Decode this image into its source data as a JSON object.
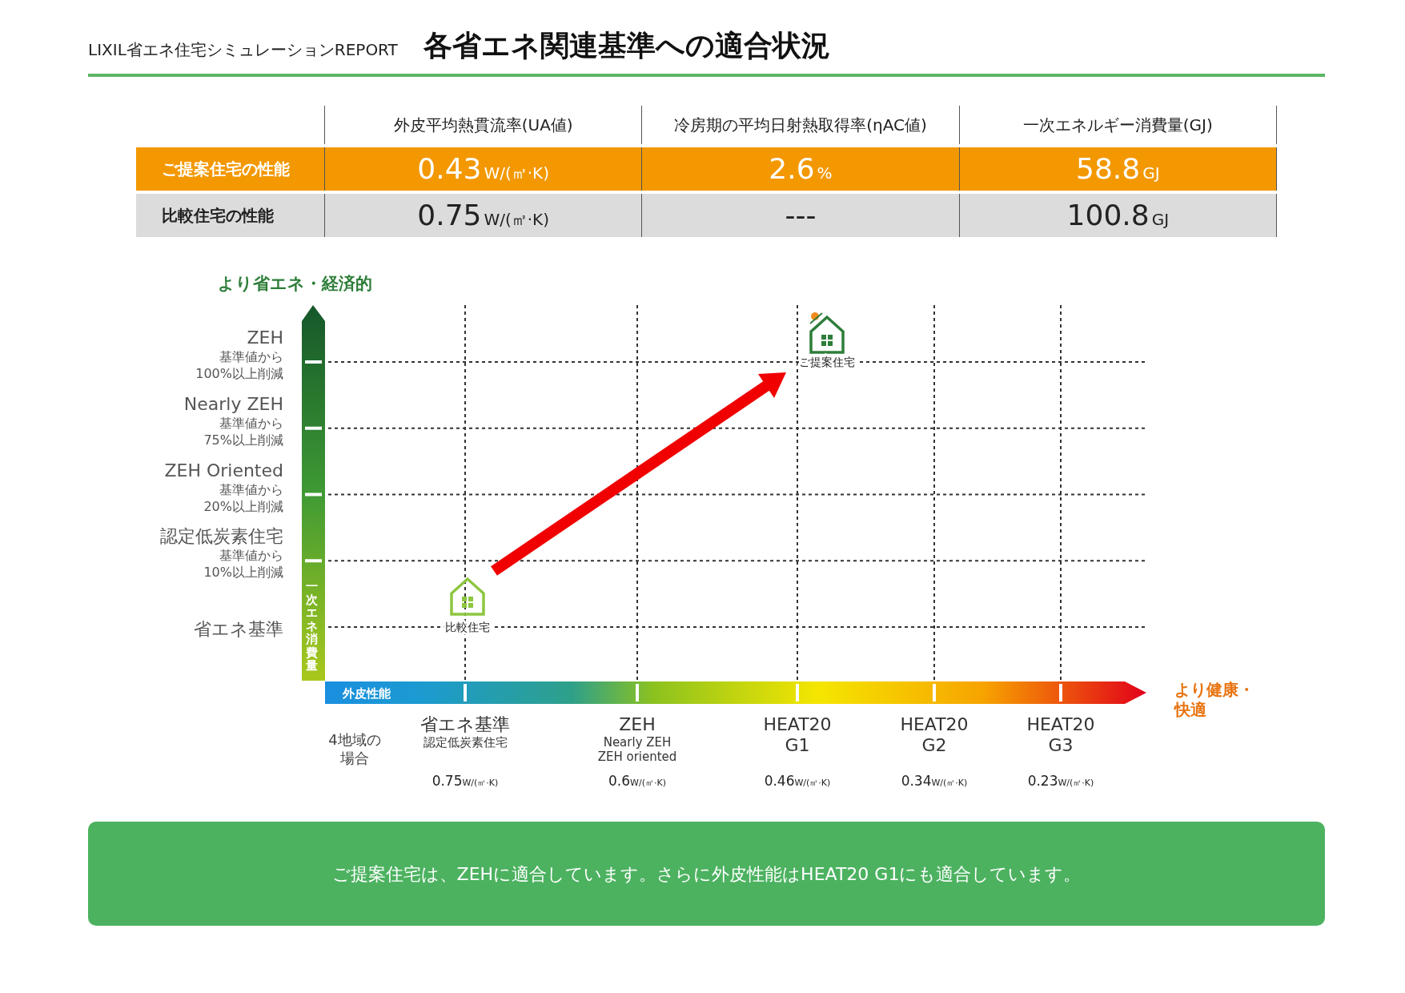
{
  "header": {
    "report_name": "LIXIL省エネ住宅シミュレーションREPORT",
    "title": "各省エネ関連基準への適合状況"
  },
  "table": {
    "columns": [
      "外皮平均熱貫流率(UA値)",
      "冷房期の平均日射熱取得率(ηAC値)",
      "一次エネルギー消費量(GJ)"
    ],
    "rows": [
      {
        "label": "ご提案住宅の性能",
        "highlighted": true,
        "cells": [
          {
            "value": "0.43",
            "unit": "W/(㎡·K)"
          },
          {
            "value": "2.6",
            "unit": "%"
          },
          {
            "value": "58.8",
            "unit": "GJ"
          }
        ]
      },
      {
        "label": "比較住宅の性能",
        "highlighted": false,
        "cells": [
          {
            "value": "0.75",
            "unit": "W/(㎡·K)"
          },
          {
            "value": "---"
          },
          {
            "value": "100.8",
            "unit": "GJ"
          }
        ]
      }
    ]
  },
  "diagram": {
    "y_axis": {
      "heading": "より省エネ・経済的",
      "bar_label": "一次エネ消費量",
      "levels": [
        {
          "title": "ZEH",
          "note": [
            "基準値から",
            "100%以上削減"
          ]
        },
        {
          "title": "Nearly ZEH",
          "note": [
            "基準値から",
            "75%以上削減"
          ]
        },
        {
          "title": "ZEH Oriented",
          "note": [
            "基準値から",
            "20%以上削減"
          ]
        },
        {
          "title": "認定低炭素住宅",
          "note": [
            "基準値から",
            "10%以上削減"
          ]
        },
        {
          "title": "省エネ基準"
        }
      ]
    },
    "x_axis": {
      "bar_label": "外皮性能",
      "heading": [
        "より健康・",
        "快適"
      ],
      "row_label": [
        "4地域の",
        "場合"
      ],
      "levels": [
        {
          "title": [
            "省エネ基準"
          ],
          "subtitle": [
            "認定低炭素住宅"
          ],
          "value": "0.75",
          "unit": "W/(㎡·K)"
        },
        {
          "title": [
            "ZEH"
          ],
          "subtitle": [
            "Nearly ZEH",
            "ZEH oriented"
          ],
          "value": "0.6",
          "unit": "W/(㎡·K)"
        },
        {
          "title": [
            "HEAT20",
            "G1"
          ],
          "value": "0.46",
          "unit": "W/(㎡·K)"
        },
        {
          "title": [
            "HEAT20",
            "G2"
          ],
          "value": "0.34",
          "unit": "W/(㎡·K)"
        },
        {
          "title": [
            "HEAT20",
            "G3"
          ],
          "value": "0.23",
          "unit": "W/(㎡·K)"
        }
      ]
    },
    "houses": [
      {
        "kind": "comparison",
        "label": "比較住宅"
      },
      {
        "kind": "proposed",
        "label": "ご提案住宅"
      }
    ]
  },
  "summary": "ご提案住宅は、ZEHに適合しています。さらに外皮性能はHEAT20 G1にも適合しています。"
}
